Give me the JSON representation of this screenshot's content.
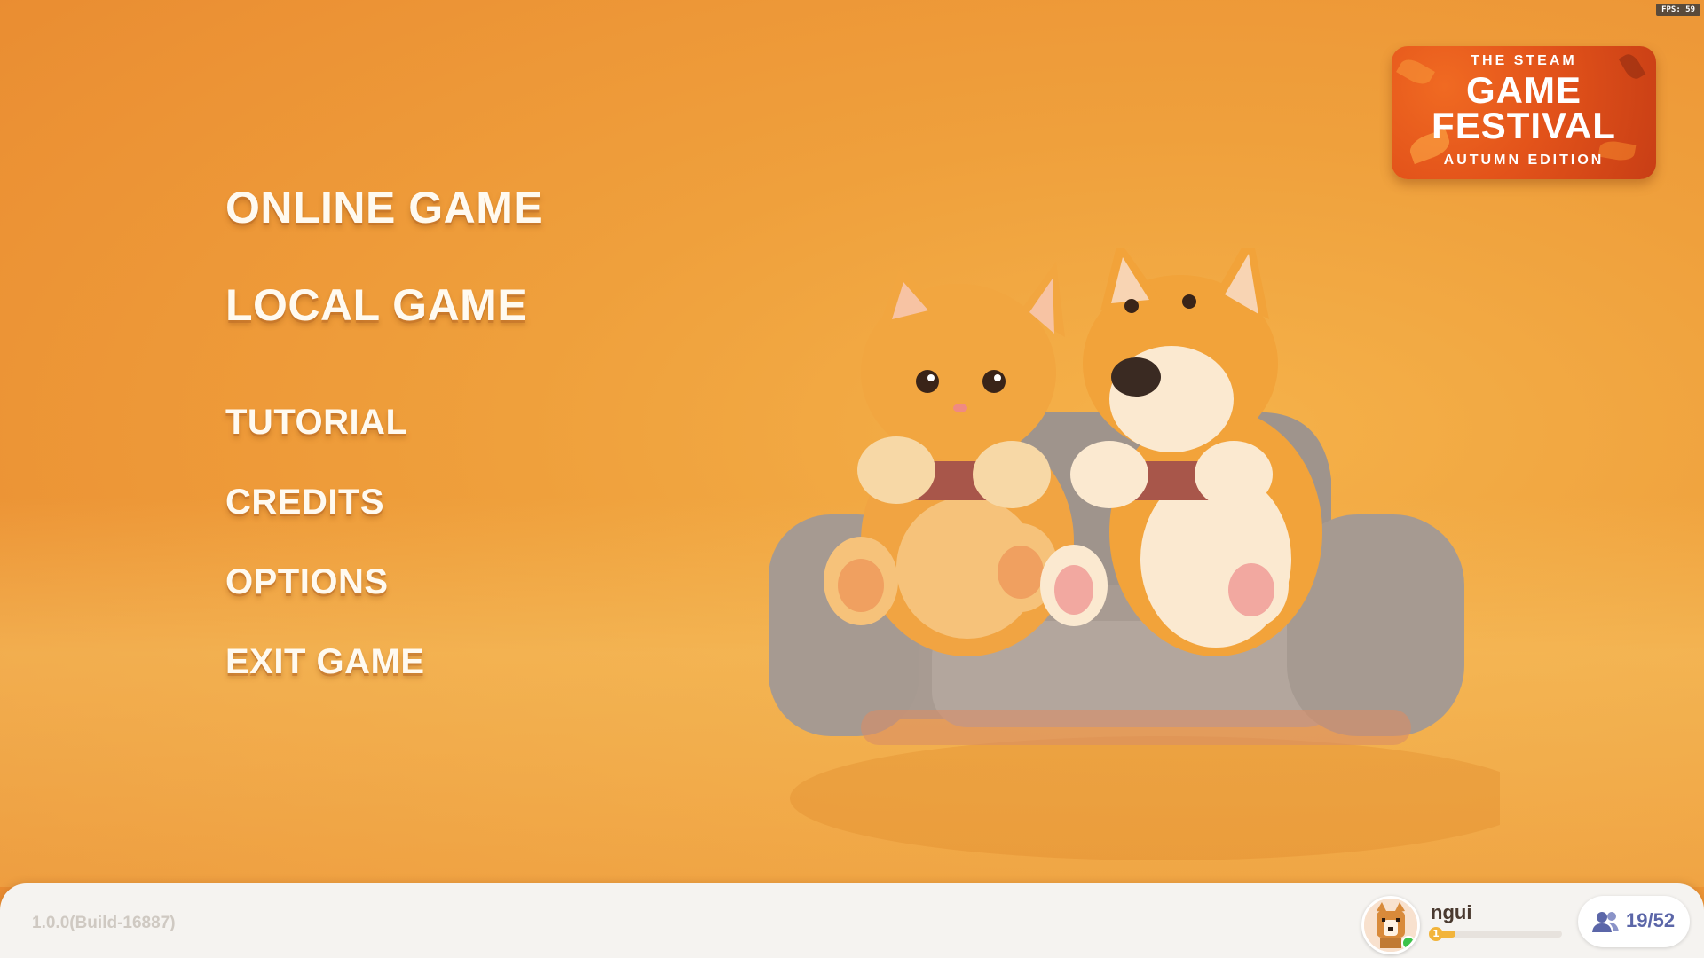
{
  "hud": {
    "fps": "FPS: 59"
  },
  "festival": {
    "line1": "THE STEAM",
    "line2": "GAME",
    "line3": "FESTIVAL",
    "line4": "AUTUMN EDITION"
  },
  "menu": {
    "online": "ONLINE GAME",
    "local": "LOCAL GAME",
    "tutorial": "TUTORIAL",
    "credits": "CREDITS",
    "options": "OPTIONS",
    "exit": "EXIT GAME"
  },
  "footer": {
    "version": "1.0.0(Build-16887)",
    "username": "ngui",
    "level": "1",
    "xp_progress": 0.18,
    "friends": "19/52"
  },
  "colors": {
    "background": "#ef9c3a",
    "menu_text": "#fffaf0",
    "badge": "#e3531a",
    "friends_text": "#5b66a8"
  }
}
